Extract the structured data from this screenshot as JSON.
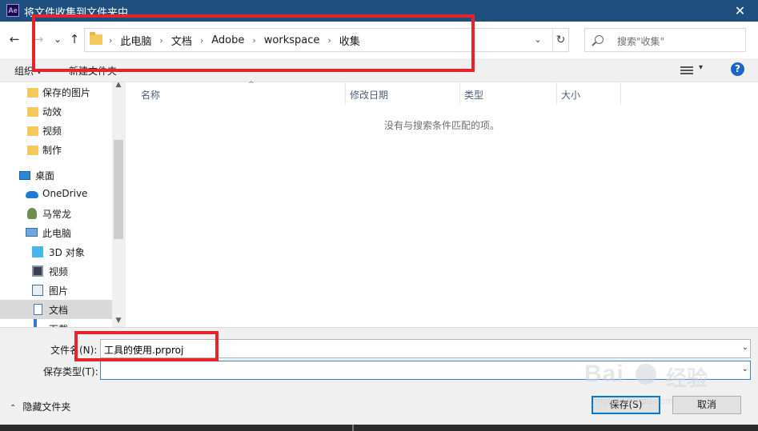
{
  "window": {
    "app_icon_text": "Ae",
    "title": "将文件收集到文件夹中",
    "close_glyph": "✕"
  },
  "nav": {
    "back_glyph": "←",
    "forward_glyph": "→",
    "recent_glyph": "⌄",
    "up_glyph": "↑",
    "breadcrumbs": [
      "此电脑",
      "文档",
      "Adobe",
      "workspace",
      "收集"
    ],
    "separator": "›",
    "dropdown_glyph": "⌄",
    "refresh_glyph": "↻",
    "search_placeholder": "搜索\"收集\""
  },
  "toolbar": {
    "organize": "组织 ▾",
    "new_folder": "新建文件夹",
    "view_dropdown_glyph": "▾",
    "help_glyph": "?"
  },
  "sidebar": {
    "items": [
      {
        "label": "保存的图片",
        "icon": "folder-icon"
      },
      {
        "label": "动效",
        "icon": "folder-icon"
      },
      {
        "label": "视频",
        "icon": "folder-icon"
      },
      {
        "label": "制作",
        "icon": "folder-icon"
      },
      {
        "label": "桌面",
        "icon": "desktop-icon"
      },
      {
        "label": "OneDrive",
        "icon": "onedrive-icon"
      },
      {
        "label": "马常龙",
        "icon": "user-icon"
      },
      {
        "label": "此电脑",
        "icon": "pc-icon"
      },
      {
        "label": "3D 对象",
        "icon": "3d-objects-icon"
      },
      {
        "label": "视频",
        "icon": "videos-icon"
      },
      {
        "label": "图片",
        "icon": "pictures-icon"
      },
      {
        "label": "文档",
        "icon": "documents-icon",
        "selected": true
      },
      {
        "label": "下载",
        "icon": "downloads-icon"
      }
    ],
    "scroll_up": "▲",
    "scroll_down": "▼"
  },
  "columns": {
    "name": "名称",
    "modified": "修改日期",
    "type": "类型",
    "size": "大小",
    "sort_glyph": "^"
  },
  "empty_message": "没有与搜索条件匹配的项。",
  "form": {
    "filename_label": "文件名(N):",
    "filename_value": "工具的使用.prproj",
    "filetype_label": "保存类型(T):",
    "filetype_value": "",
    "dropdown_glyph": "⌄"
  },
  "footer": {
    "hide_folders": "隐藏文件夹",
    "hide_chevron": "⌃",
    "save": "保存(S)",
    "cancel": "取消"
  },
  "watermark": {
    "brand": "Bai",
    "brand_cn": "经验",
    "url": "jingyan.baidu.com"
  },
  "colors": {
    "titlebar": "#1e4f7f",
    "highlight_box": "#e8232a",
    "accent": "#0078d7"
  }
}
